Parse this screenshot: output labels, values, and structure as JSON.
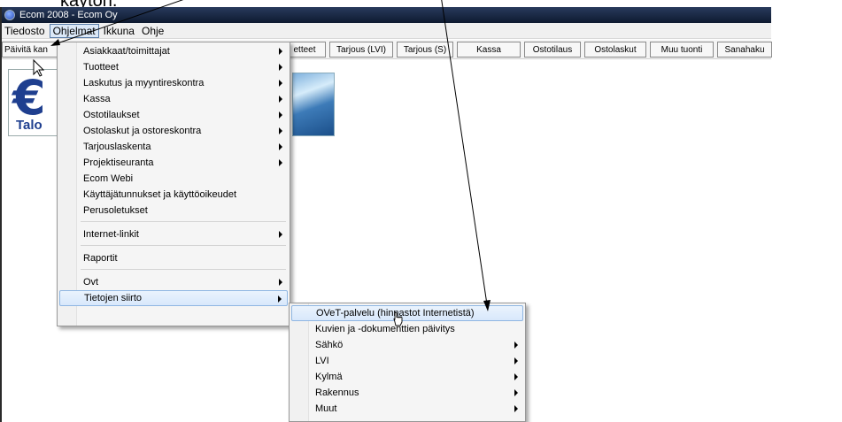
{
  "caption": "käytön.",
  "window": {
    "title": "Ecom 2008 - Ecom Oy"
  },
  "menubar": [
    "Tiedosto",
    "Ohjelmat",
    "Ikkuna",
    "Ohje"
  ],
  "toolbar": {
    "left_label": "Päivitä kan",
    "buttons": [
      "etteet",
      "Tarjous (LVI)",
      "Tarjous (S)",
      "Kassa",
      "Ostotilaus",
      "Ostolaskut",
      "Muu tuonti",
      "Sanahaku"
    ]
  },
  "logo": {
    "text": "Talo"
  },
  "ohjelmat_menu": {
    "items": [
      {
        "label": "Asiakkaat/toimittajat",
        "submenu": true
      },
      {
        "label": "Tuotteet",
        "submenu": true
      },
      {
        "label": "Laskutus ja myyntireskontra",
        "submenu": true
      },
      {
        "label": "Kassa",
        "submenu": true
      },
      {
        "label": "Ostotilaukset",
        "submenu": true
      },
      {
        "label": "Ostolaskut ja ostoreskontra",
        "submenu": true
      },
      {
        "label": "Tarjouslaskenta",
        "submenu": true
      },
      {
        "label": "Projektiseuranta",
        "submenu": true
      },
      {
        "label": "Ecom Webi",
        "submenu": false
      },
      {
        "label": "Käyttäjätunnukset ja käyttöoikeudet",
        "submenu": false
      },
      {
        "label": "Perusoletukset",
        "submenu": false
      },
      {
        "label": "Internet-linkit",
        "submenu": true
      },
      {
        "label": "Raportit",
        "submenu": false
      },
      {
        "label": "Ovt",
        "submenu": true
      },
      {
        "label": "Tietojen siirto",
        "submenu": true
      }
    ],
    "highlighted": "Tietojen siirto"
  },
  "tietojen_siirto_menu": {
    "items": [
      {
        "label": "OVeT-palvelu (hinnastot Internetistä)",
        "submenu": false
      },
      {
        "label": "Kuvien ja -dokumenttien päivitys",
        "submenu": false
      },
      {
        "label": "Sähkö",
        "submenu": true
      },
      {
        "label": "LVI",
        "submenu": true
      },
      {
        "label": "Kylmä",
        "submenu": true
      },
      {
        "label": "Rakennus",
        "submenu": true
      },
      {
        "label": "Muut",
        "submenu": true
      }
    ],
    "highlighted": "OVeT-palvelu (hinnastot Internetistä)"
  },
  "colors": {
    "titlebar": "#1a2a48",
    "highlight": "#d8e8fb",
    "highlight_border": "#8fb6e2"
  }
}
